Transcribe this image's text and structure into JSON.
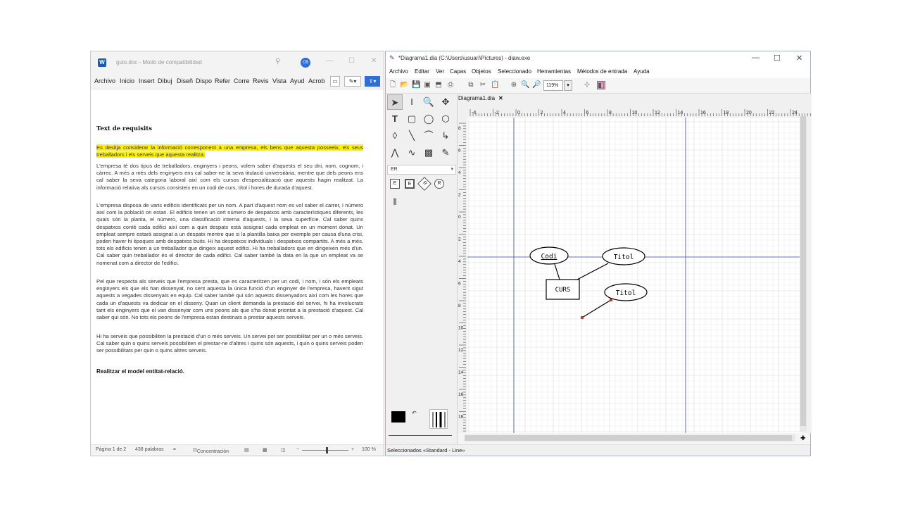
{
  "word": {
    "title": "guio.doc - Modo de compatibilidad",
    "avatar": "CB",
    "ribbon_tabs": [
      "Archivo",
      "Inicio",
      "Insert",
      "Dibuj",
      "Diseñ",
      "Dispo",
      "Refer",
      "Corre",
      "Revis",
      "Vista",
      "Ayud",
      "Acrob"
    ],
    "heading": "Text de requisits",
    "highlighted": "Es desitja considerar la informació corresponent a una empresa, els bens que aquesta posseeix, els seus treballadors i els serveis que aquesta realitza.",
    "p1": "L'empresa té dos tipus de treballadors, enginyers i peons, volem saber d'aquests el seu dni, nom, cognom, i càrrec. A més a més dels enginyers ens cal saber-ne la seva titulació universitària, mentre que dels peons ens cal saber la seva categoria laboral així com els cursos d'especialització que aquests hagin realitzat. La informació relativa als cursos consisteix en un codi de curs, títol i hores de durada d'aquest.",
    "p2": "L'empresa disposa de varis edificis identificats per un nom. A part d'aquest nom es vol saber el carrer, i número així com la població on estan. El edificis tenen un cert número de despatxos amb característiques diferents, les quals són la planta, el número, una classificació interna d'aquests, i la seva superfície. Cal saber quins despatxos conté cada edifici així com a quin despatx està assignat cada empleat en un moment donat. Un empleat sempre estarà assignat a un despatx mentre que si la plantilla baixa per exemple per causa d'una crisi, poden haver hi èpoques amb despatxos buits. Hi ha despatxos individuals i despatxos compartits. A més a més, tots els edificis tenen a un treballador que dirigeix aquest edifici. Hi ha treballadors que en dirigeixen més d'un. Cal saber quin treballador és el director de cada edifici. Cal saber també la data en la que un empleat va se nomenat com a director de l'edifici.",
    "p3": "Pel que respecta als serveis que l'empresa presta, que es caracteritzen per un codi, i nom, i són els empleats enginyers els que els han dissenyat, no sent aquesta la única funció d'un enginyer de l'empresa, havent sigut aquests a vegades dissenyats en equip. Cal saber també qui són aquests dissenyadors així com les hores que cada un d'aquests va dedicar en el disseny. Quan un client demanda la prestació del servei, hi ha involucrats tant els enginyers que el van dissenyar com uns peons als que s'ha donat prioritat a la prestació d'aquest. Cal saber qui són. No tots els peons de l'empresa estan destinats a prestar aquests serveis.",
    "p4": "Hi ha serveis que possibiliten la prestació d'un o més serveis. Un servei pot ser possibilitat per un o més serveis. Cal saber quin o quins serveis possibiliten el prestar-ne d'altres i quins són aquests, i quin o quins serveis poden ser possibilitats per quin o quins altres serveis.",
    "task": "Realitzar el model entitat-relació.",
    "status": {
      "page": "Página 1 de 2",
      "words": "438 palabras",
      "focus": "Concentración",
      "zoom": "100 %"
    }
  },
  "dia": {
    "title": "*Diagrama1.dia (C:\\Users\\usuari\\Pictures) - diaw.exe",
    "menu": [
      "Archivo",
      "Editar",
      "Ver",
      "Capas",
      "Objetos",
      "Seleccionado",
      "Herramientas",
      "Métodos de entrada",
      "Ayuda"
    ],
    "zoom": "119%",
    "sheet": "ER",
    "er_tools": [
      "E",
      "E",
      "R",
      "R"
    ],
    "doc_tab": "Diagrama1.dia",
    "ruler_labels": [
      "-4",
      "-2",
      "0",
      "2",
      "4",
      "6",
      "8",
      "10",
      "12",
      "14",
      "16",
      "18",
      "20",
      "22",
      "24"
    ],
    "vruler_labels": [
      "8",
      "6",
      "4",
      "2",
      "0",
      "2",
      "4",
      "6",
      "8",
      "10",
      "12",
      "14",
      "16",
      "18"
    ],
    "diagram": {
      "attr1": "Codi",
      "attr2": "Titol",
      "attr3": "Titol",
      "entity": "CURS"
    },
    "status": "Seleccionados «Standard - Line»"
  },
  "colors": {
    "highlight": "#fff200",
    "dia_accent_line": "#3a4aa0",
    "handle": "#c0392b"
  }
}
